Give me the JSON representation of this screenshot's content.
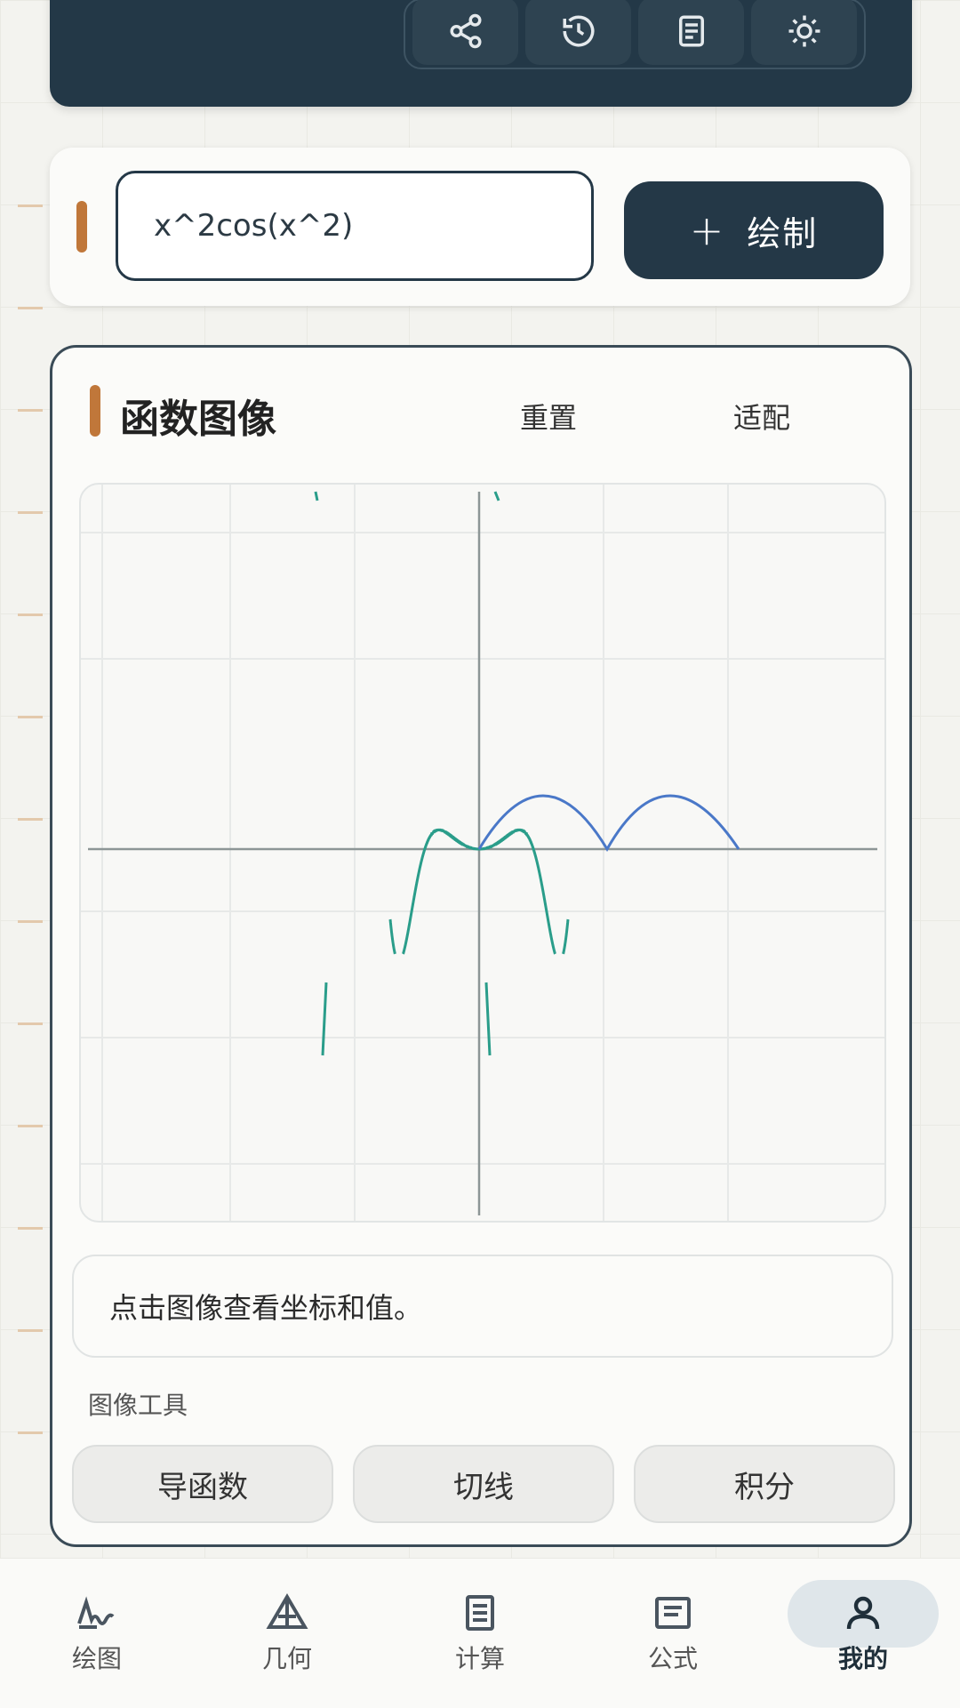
{
  "toolbar": {
    "icons": [
      "share-icon",
      "history-icon",
      "document-icon",
      "settings-icon"
    ]
  },
  "input": {
    "value": "x^2cos(x^2)",
    "plot_button_label": "绘制",
    "plot_button_icon": "+"
  },
  "graph": {
    "title": "函数图像",
    "reset_label": "重置",
    "fit_label": "适配"
  },
  "info": {
    "text": "点击图像查看坐标和值。"
  },
  "tools": {
    "label": "图像工具",
    "items": [
      "导函数",
      "切线",
      "积分"
    ]
  },
  "nav": {
    "items": [
      {
        "label": "绘图",
        "icon": "plot-icon"
      },
      {
        "label": "几何",
        "icon": "geometry-icon"
      },
      {
        "label": "计算",
        "icon": "calculate-icon"
      },
      {
        "label": "公式",
        "icon": "formula-icon"
      },
      {
        "label": "我的",
        "icon": "profile-icon"
      }
    ],
    "active_index": 4
  },
  "chart_data": {
    "type": "line",
    "series": [
      {
        "expression": "x^2cos(x^2)",
        "color": "#2a9d8a"
      },
      {
        "expression": "",
        "color": "#4a78c8"
      }
    ],
    "colors": {
      "accent": "#c0773a",
      "primary": "#243847"
    }
  }
}
